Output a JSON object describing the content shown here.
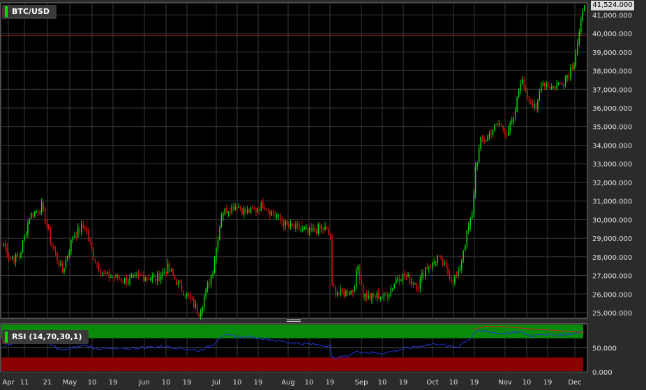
{
  "chart_data": [
    {
      "type": "candlestick",
      "title": "BTC/USD",
      "last_price_label": "41,524.000",
      "y_ticks": [
        "25,000.000",
        "26,000.000",
        "27,000.000",
        "28,000.000",
        "29,000.000",
        "30,000.000",
        "31,000.000",
        "32,000.000",
        "33,000.000",
        "34,000.000",
        "35,000.000",
        "36,000.000",
        "37,000.000",
        "38,000.000",
        "39,000.000",
        "40,000.000",
        "41,000.000"
      ],
      "y_tick_values": [
        25000,
        26000,
        27000,
        28000,
        29000,
        30000,
        31000,
        32000,
        33000,
        34000,
        35000,
        36000,
        37000,
        38000,
        39000,
        40000,
        41000
      ],
      "ylim": [
        24700,
        41650
      ],
      "reference_line": 39900,
      "x_ticks": [
        "Apr",
        "11",
        "21",
        "May",
        "10",
        "19",
        "Jun",
        "10",
        "19",
        "Jul",
        "10",
        "19",
        "Aug",
        "10",
        "19",
        "Sep",
        "10",
        "19",
        "Oct",
        "10",
        "19",
        "Nov",
        "10",
        "19",
        "Dec"
      ],
      "close_anchors": [
        [
          0,
          28700
        ],
        [
          4,
          27900
        ],
        [
          9,
          28000
        ],
        [
          15,
          30200
        ],
        [
          22,
          30700
        ],
        [
          28,
          28600
        ],
        [
          34,
          27200
        ],
        [
          40,
          29100
        ],
        [
          47,
          29700
        ],
        [
          52,
          28000
        ],
        [
          58,
          27000
        ],
        [
          65,
          26900
        ],
        [
          72,
          26700
        ],
        [
          80,
          27000
        ],
        [
          88,
          26800
        ],
        [
          95,
          27400
        ],
        [
          102,
          26400
        ],
        [
          108,
          25700
        ],
        [
          113,
          25000
        ],
        [
          117,
          26100
        ],
        [
          121,
          27300
        ],
        [
          126,
          30300
        ],
        [
          130,
          30600
        ],
        [
          135,
          30800
        ],
        [
          140,
          30400
        ],
        [
          145,
          30500
        ],
        [
          150,
          30800
        ],
        [
          155,
          30400
        ],
        [
          160,
          30000
        ],
        [
          165,
          29600
        ],
        [
          170,
          29500
        ],
        [
          176,
          29300
        ],
        [
          182,
          29500
        ],
        [
          186,
          29500
        ],
        [
          189,
          29000
        ],
        [
          190,
          26400
        ],
        [
          194,
          26000
        ],
        [
          198,
          26100
        ],
        [
          202,
          26200
        ],
        [
          205,
          27500
        ],
        [
          208,
          26000
        ],
        [
          212,
          25800
        ],
        [
          216,
          25900
        ],
        [
          220,
          25800
        ],
        [
          224,
          26300
        ],
        [
          228,
          26900
        ],
        [
          232,
          27000
        ],
        [
          236,
          26700
        ],
        [
          240,
          26500
        ],
        [
          244,
          27400
        ],
        [
          248,
          27600
        ],
        [
          251,
          28000
        ],
        [
          254,
          27600
        ],
        [
          257,
          27100
        ],
        [
          260,
          26800
        ],
        [
          263,
          27000
        ],
        [
          266,
          28400
        ],
        [
          269,
          29600
        ],
        [
          271,
          30200
        ],
        [
          273,
          32800
        ],
        [
          276,
          34200
        ],
        [
          279,
          34300
        ],
        [
          283,
          34900
        ],
        [
          287,
          35100
        ],
        [
          291,
          34700
        ],
        [
          295,
          35300
        ],
        [
          299,
          37500
        ],
        [
          302,
          37000
        ],
        [
          305,
          36300
        ],
        [
          308,
          35800
        ],
        [
          311,
          37400
        ],
        [
          314,
          37300
        ],
        [
          317,
          37100
        ],
        [
          320,
          37200
        ],
        [
          324,
          37500
        ],
        [
          327,
          37900
        ],
        [
          330,
          38500
        ],
        [
          333,
          40000
        ],
        [
          336,
          41524
        ]
      ]
    },
    {
      "type": "line",
      "title": "RSI (14,70,30,1)",
      "y_ticks": [
        "50.000",
        "0.000"
      ],
      "y_tick_values": [
        50,
        0
      ],
      "ylim": [
        0,
        100
      ],
      "overbought": 70,
      "oversold": 30,
      "series": [
        {
          "color": "#2233dd",
          "anchors": [
            [
              0,
              55
            ],
            [
              15,
              70
            ],
            [
              22,
              66
            ],
            [
              34,
              44
            ],
            [
              47,
              56
            ],
            [
              52,
              50
            ],
            [
              65,
              47
            ],
            [
              80,
              51
            ],
            [
              95,
              53
            ],
            [
              113,
              44
            ],
            [
              121,
              56
            ],
            [
              126,
              76
            ],
            [
              135,
              74
            ],
            [
              150,
              70
            ],
            [
              165,
              61
            ],
            [
              176,
              58
            ],
            [
              189,
              55
            ],
            [
              190,
              28
            ],
            [
              198,
              32
            ],
            [
              205,
              43
            ],
            [
              212,
              40
            ],
            [
              220,
              39
            ],
            [
              232,
              48
            ],
            [
              244,
              56
            ],
            [
              251,
              59
            ],
            [
              257,
              53
            ],
            [
              263,
              52
            ],
            [
              266,
              62
            ],
            [
              270,
              69
            ],
            [
              273,
              84
            ],
            [
              279,
              85
            ],
            [
              287,
              80
            ],
            [
              295,
              81
            ],
            [
              299,
              83
            ],
            [
              305,
              74
            ],
            [
              311,
              80
            ],
            [
              317,
              76
            ],
            [
              324,
              78
            ],
            [
              330,
              79
            ],
            [
              336,
              86
            ]
          ]
        },
        {
          "color": "#cc2222",
          "anchors": [
            [
              271,
              88
            ],
            [
              279,
              95
            ],
            [
              290,
              94
            ],
            [
              300,
              91
            ],
            [
              312,
              88
            ],
            [
              324,
              85
            ],
            [
              336,
              82
            ]
          ]
        }
      ]
    }
  ],
  "colors": {
    "background": "#000000",
    "frame": "#2b2b2b",
    "grid": "#3a3a3a",
    "up": "#00dd00",
    "down": "#dd1111",
    "reference_line": "#b03030",
    "overbought_band": "#0a8a0a",
    "oversold_band": "#8a0000",
    "axis_text": "#dddddd"
  }
}
